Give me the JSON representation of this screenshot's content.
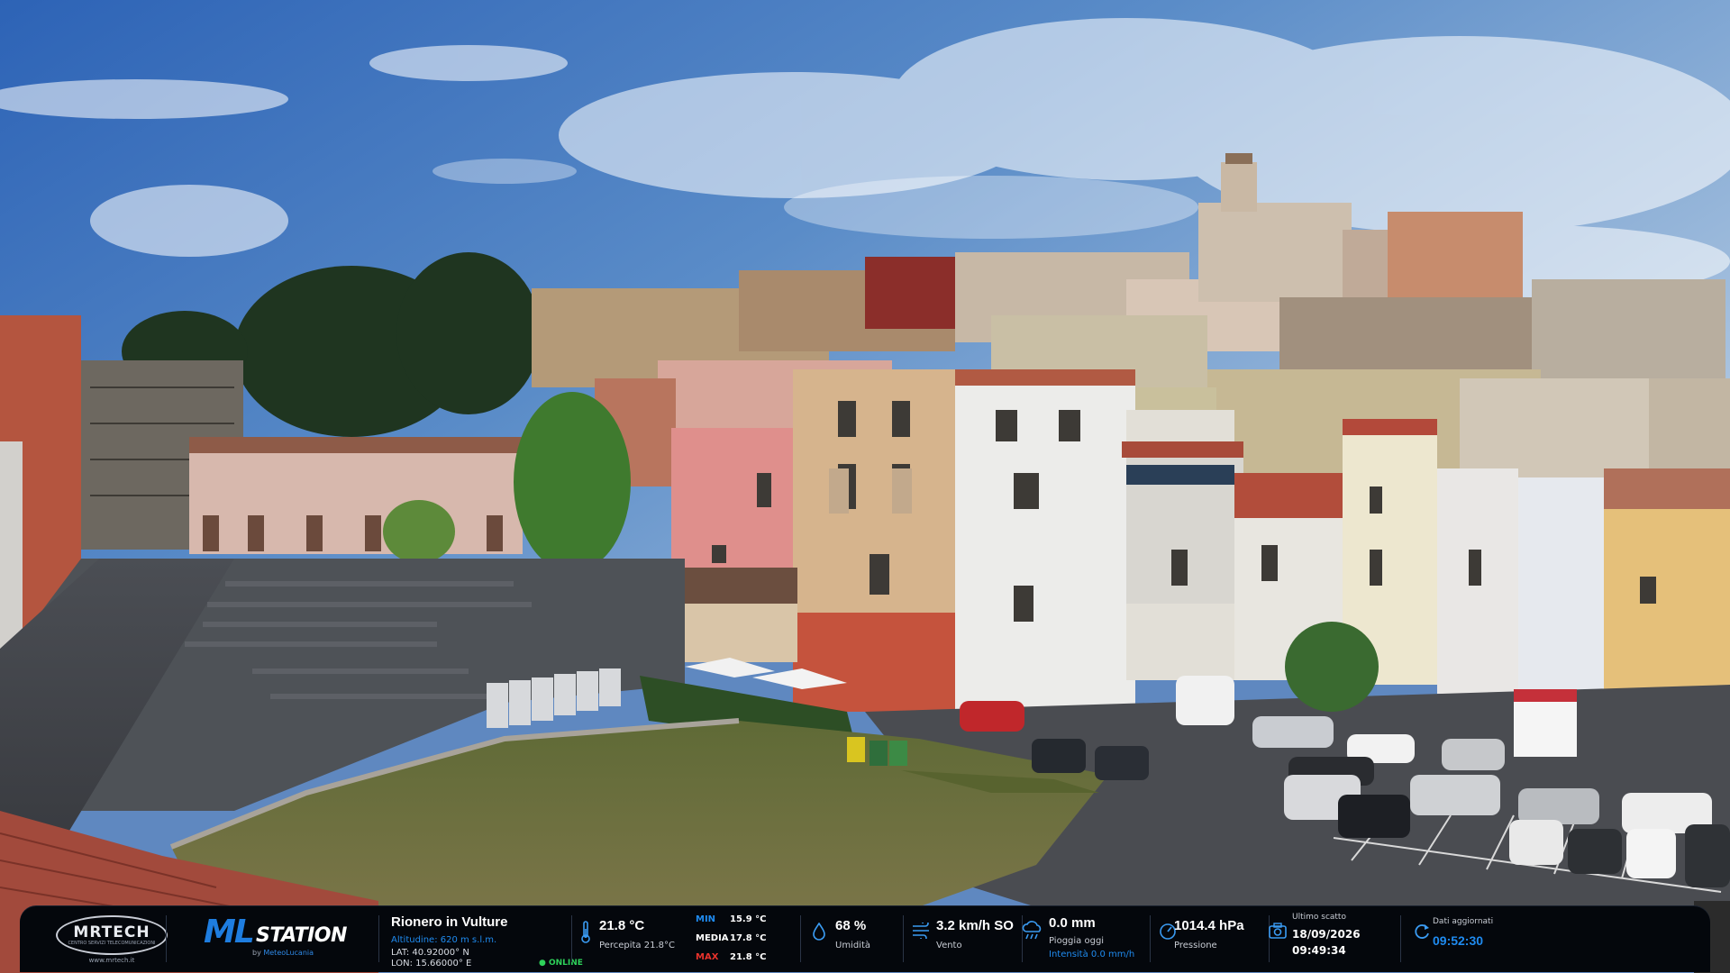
{
  "branding": {
    "mrtech_logo": "MRTECH",
    "mrtech_tagline": "CENTRO SERVIZI TELECOMUNICAZIONI",
    "mrtech_url": "www.mrtech.it",
    "ml_big": "ML",
    "ml_station": "STATION",
    "ml_by_prefix": "by",
    "ml_by_name": "MeteoLucania"
  },
  "location": {
    "city": "Rionero in Vulture",
    "altitude": "Altitudine: 620 m s.l.m.",
    "lat": "LAT: 40.92000° N",
    "lon": "LON: 15.66000° E",
    "status": "● ONLINE"
  },
  "temperature": {
    "value": "21.8 °C",
    "perceived": "Percepita 21.8°C",
    "min_label": "MIN",
    "min_value": "15.9 °C",
    "avg_label": "MEDIA",
    "avg_value": "17.8 °C",
    "max_label": "MAX",
    "max_value": "21.8 °C"
  },
  "humidity": {
    "value": "68 %",
    "label": "Umidità"
  },
  "wind": {
    "value": "3.2 km/h SO",
    "label": "Vento"
  },
  "rain": {
    "value": "0.0 mm",
    "label": "Pioggia oggi",
    "intensity": "Intensità 0.0 mm/h"
  },
  "pressure": {
    "value": "1014.4 hPa",
    "label": "Pressione"
  },
  "last_shot": {
    "label": "Ultimo scatto",
    "date": "18/09/2026",
    "time": "09:49:34"
  },
  "updated": {
    "label": "Dati aggiornati",
    "time": "09:52:30"
  },
  "colors": {
    "accent_blue": "#1f8bf0",
    "min_color": "#1f8bf0",
    "max_color": "#e8322c",
    "online_green": "#2ed15a",
    "bar_bg": "#04070c"
  },
  "icons": [
    "thermometer-icon",
    "droplet-icon",
    "wind-icon",
    "rain-cloud-icon",
    "gauge-icon",
    "camera-icon",
    "refresh-icon"
  ]
}
